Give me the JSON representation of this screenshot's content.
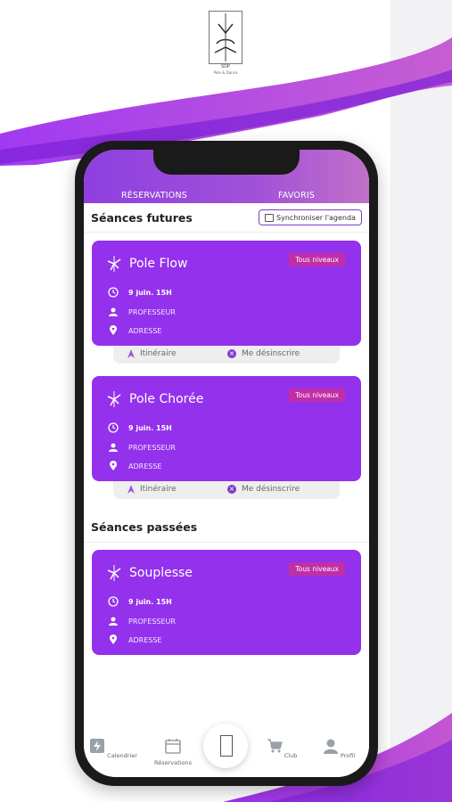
{
  "brand": {
    "caption": "SDP",
    "subcaption": "Pole & Dance"
  },
  "tabs": {
    "reservations": "RÉSERVATIONS",
    "favoris": "FAVORIS"
  },
  "upcoming": {
    "title": "Séances futures",
    "sync_label": "Synchroniser l'agenda"
  },
  "past": {
    "title": "Séances passées"
  },
  "sessions_upcoming": [
    {
      "title": "Pole Flow",
      "badge": "Tous niveaux",
      "date": "9 juin. 15H",
      "teacher": "PROFESSEUR",
      "address": "ADRESSE",
      "itinerary": "Itinéraire",
      "unsubscribe": "Me désinscrire"
    },
    {
      "title": "Pole Chorée",
      "badge": "Tous niveaux",
      "date": "9 juin. 15H",
      "teacher": "PROFESSEUR",
      "address": "ADRESSE",
      "itinerary": "Itinéraire",
      "unsubscribe": "Me désinscrire"
    }
  ],
  "sessions_past": [
    {
      "title": "Souplesse",
      "badge": "Tous niveaux",
      "date": "9 juin. 15H",
      "teacher": "PROFESSEUR",
      "address": "ADRESSE"
    }
  ],
  "bottom_nav": {
    "calendrier": "Calendrier",
    "reservations": "Réservations",
    "club": "Club",
    "profil": "Profil"
  },
  "colors": {
    "card": "#9431ec",
    "badge": "#c02fa6",
    "accent": "#7c3ad2"
  },
  "icons": [
    "dancer-icon",
    "clock-icon",
    "person-icon",
    "location-pin-icon",
    "navigation-arrow-icon",
    "close-circle-icon",
    "calendar-icon",
    "cart-icon",
    "user-icon",
    "bolt-icon"
  ]
}
